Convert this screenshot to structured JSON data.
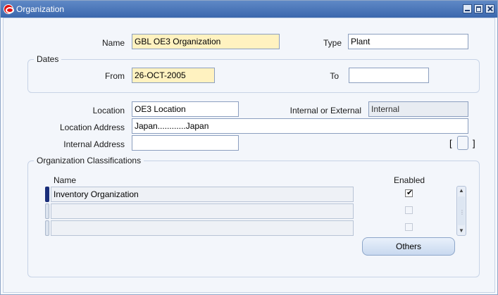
{
  "window": {
    "title": "Organization"
  },
  "header": {
    "name_label": "Name",
    "name_value": "GBL OE3 Organization",
    "type_label": "Type",
    "type_value": "Plant"
  },
  "dates": {
    "group_title": "Dates",
    "from_label": "From",
    "from_value": "26-OCT-2005",
    "to_label": "To",
    "to_value": ""
  },
  "location": {
    "location_label": "Location",
    "location_value": "OE3 Location",
    "int_ext_label": "Internal or External",
    "int_ext_value": "Internal",
    "address_label": "Location Address",
    "address_value": "Japan............Japan",
    "internal_address_label": "Internal Address",
    "internal_address_value": "",
    "bracket_open": "[",
    "bracket_close": "]"
  },
  "classifications": {
    "group_title": "Organization Classifications",
    "name_header": "Name",
    "enabled_header": "Enabled",
    "rows": [
      {
        "name": "Inventory Organization",
        "enabled": true
      },
      {
        "name": "",
        "enabled": false
      },
      {
        "name": "",
        "enabled": false
      }
    ],
    "others_button": "Others"
  }
}
